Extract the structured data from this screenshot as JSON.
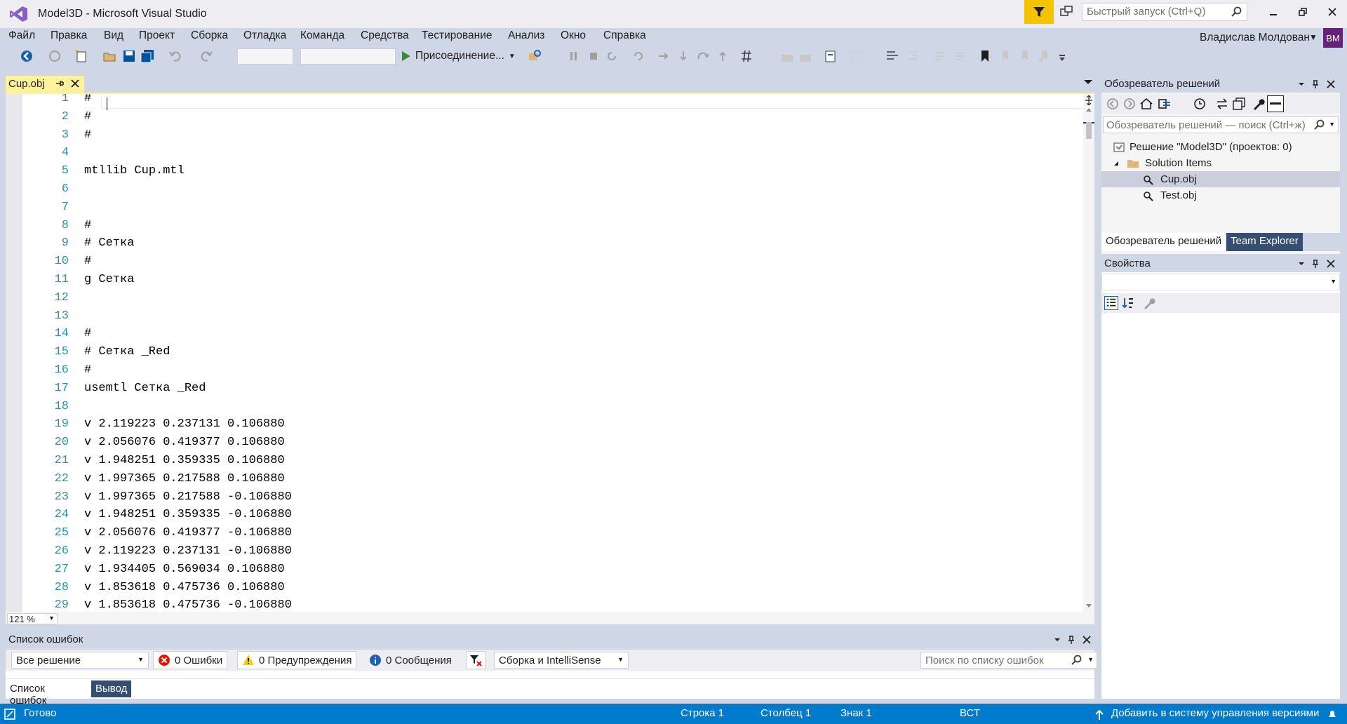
{
  "window": {
    "title": "Model3D - Microsoft Visual Studio",
    "quick_launch_placeholder": "Быстрый запуск (Ctrl+Q)"
  },
  "menu": [
    "Файл",
    "Правка",
    "Вид",
    "Проект",
    "Сборка",
    "Отладка",
    "Команда",
    "Средства",
    "Тестирование",
    "Анализ",
    "Окно",
    "Справка"
  ],
  "user": {
    "name": "Владислав Молдован",
    "initials": "ВМ"
  },
  "toolbar": {
    "attach_label": "Присоединение..."
  },
  "editor": {
    "tab_label": "Cup.obj",
    "zoom": "121 %",
    "lines": [
      "#",
      "#",
      "#",
      "",
      "mtllib Cup.mtl",
      "",
      "",
      "#",
      "# Сетка",
      "#",
      "g Сетка",
      "",
      "",
      "#",
      "# Сетка _Red",
      "#",
      "usemtl Сетка _Red",
      "",
      "v 2.119223 0.237131 0.106880",
      "v 2.056076 0.419377 0.106880",
      "v 1.948251 0.359335 0.106880",
      "v 1.997365 0.217588 0.106880",
      "v 1.997365 0.217588 -0.106880",
      "v 1.948251 0.359335 -0.106880",
      "v 2.056076 0.419377 -0.106880",
      "v 2.119223 0.237131 -0.106880",
      "v 1.934405 0.569034 0.106880",
      "v 1.853618 0.475736 0.106880",
      "v 1.853618 0.475736 -0.106880"
    ]
  },
  "error_list": {
    "title": "Список ошибок",
    "scope": "Все решение",
    "errors": "0 Ошибки",
    "warnings": "0 Предупреждения",
    "messages": "0 Сообщения",
    "source": "Сборка и IntelliSense",
    "search_placeholder": "Поиск по списку ошибок",
    "tabs": [
      "Список ошибок",
      "Вывод"
    ]
  },
  "solution_explorer": {
    "title": "Обозреватель решений",
    "search_placeholder": "Обозреватель решений — поиск (Ctrl+ж)",
    "solution": "Решение \"Model3D\"  (проектов: 0)",
    "folder": "Solution Items",
    "files": [
      "Cup.obj",
      "Test.obj"
    ],
    "tabs": [
      "Обозреватель решений",
      "Team Explorer"
    ]
  },
  "properties": {
    "title": "Свойства"
  },
  "status": {
    "ready": "Готово",
    "row": "Строка 1",
    "column": "Столбец 1",
    "char": "Знак 1",
    "mode": "ВСТ",
    "source_control": "Добавить в систему управления версиями"
  },
  "colors": {
    "accent": "#007acc",
    "tab_active": "#fff29d",
    "chrome": "#cfd6e5",
    "line_number": "#2b91af",
    "avatar": "#68217a",
    "filter": "#f5c400"
  }
}
